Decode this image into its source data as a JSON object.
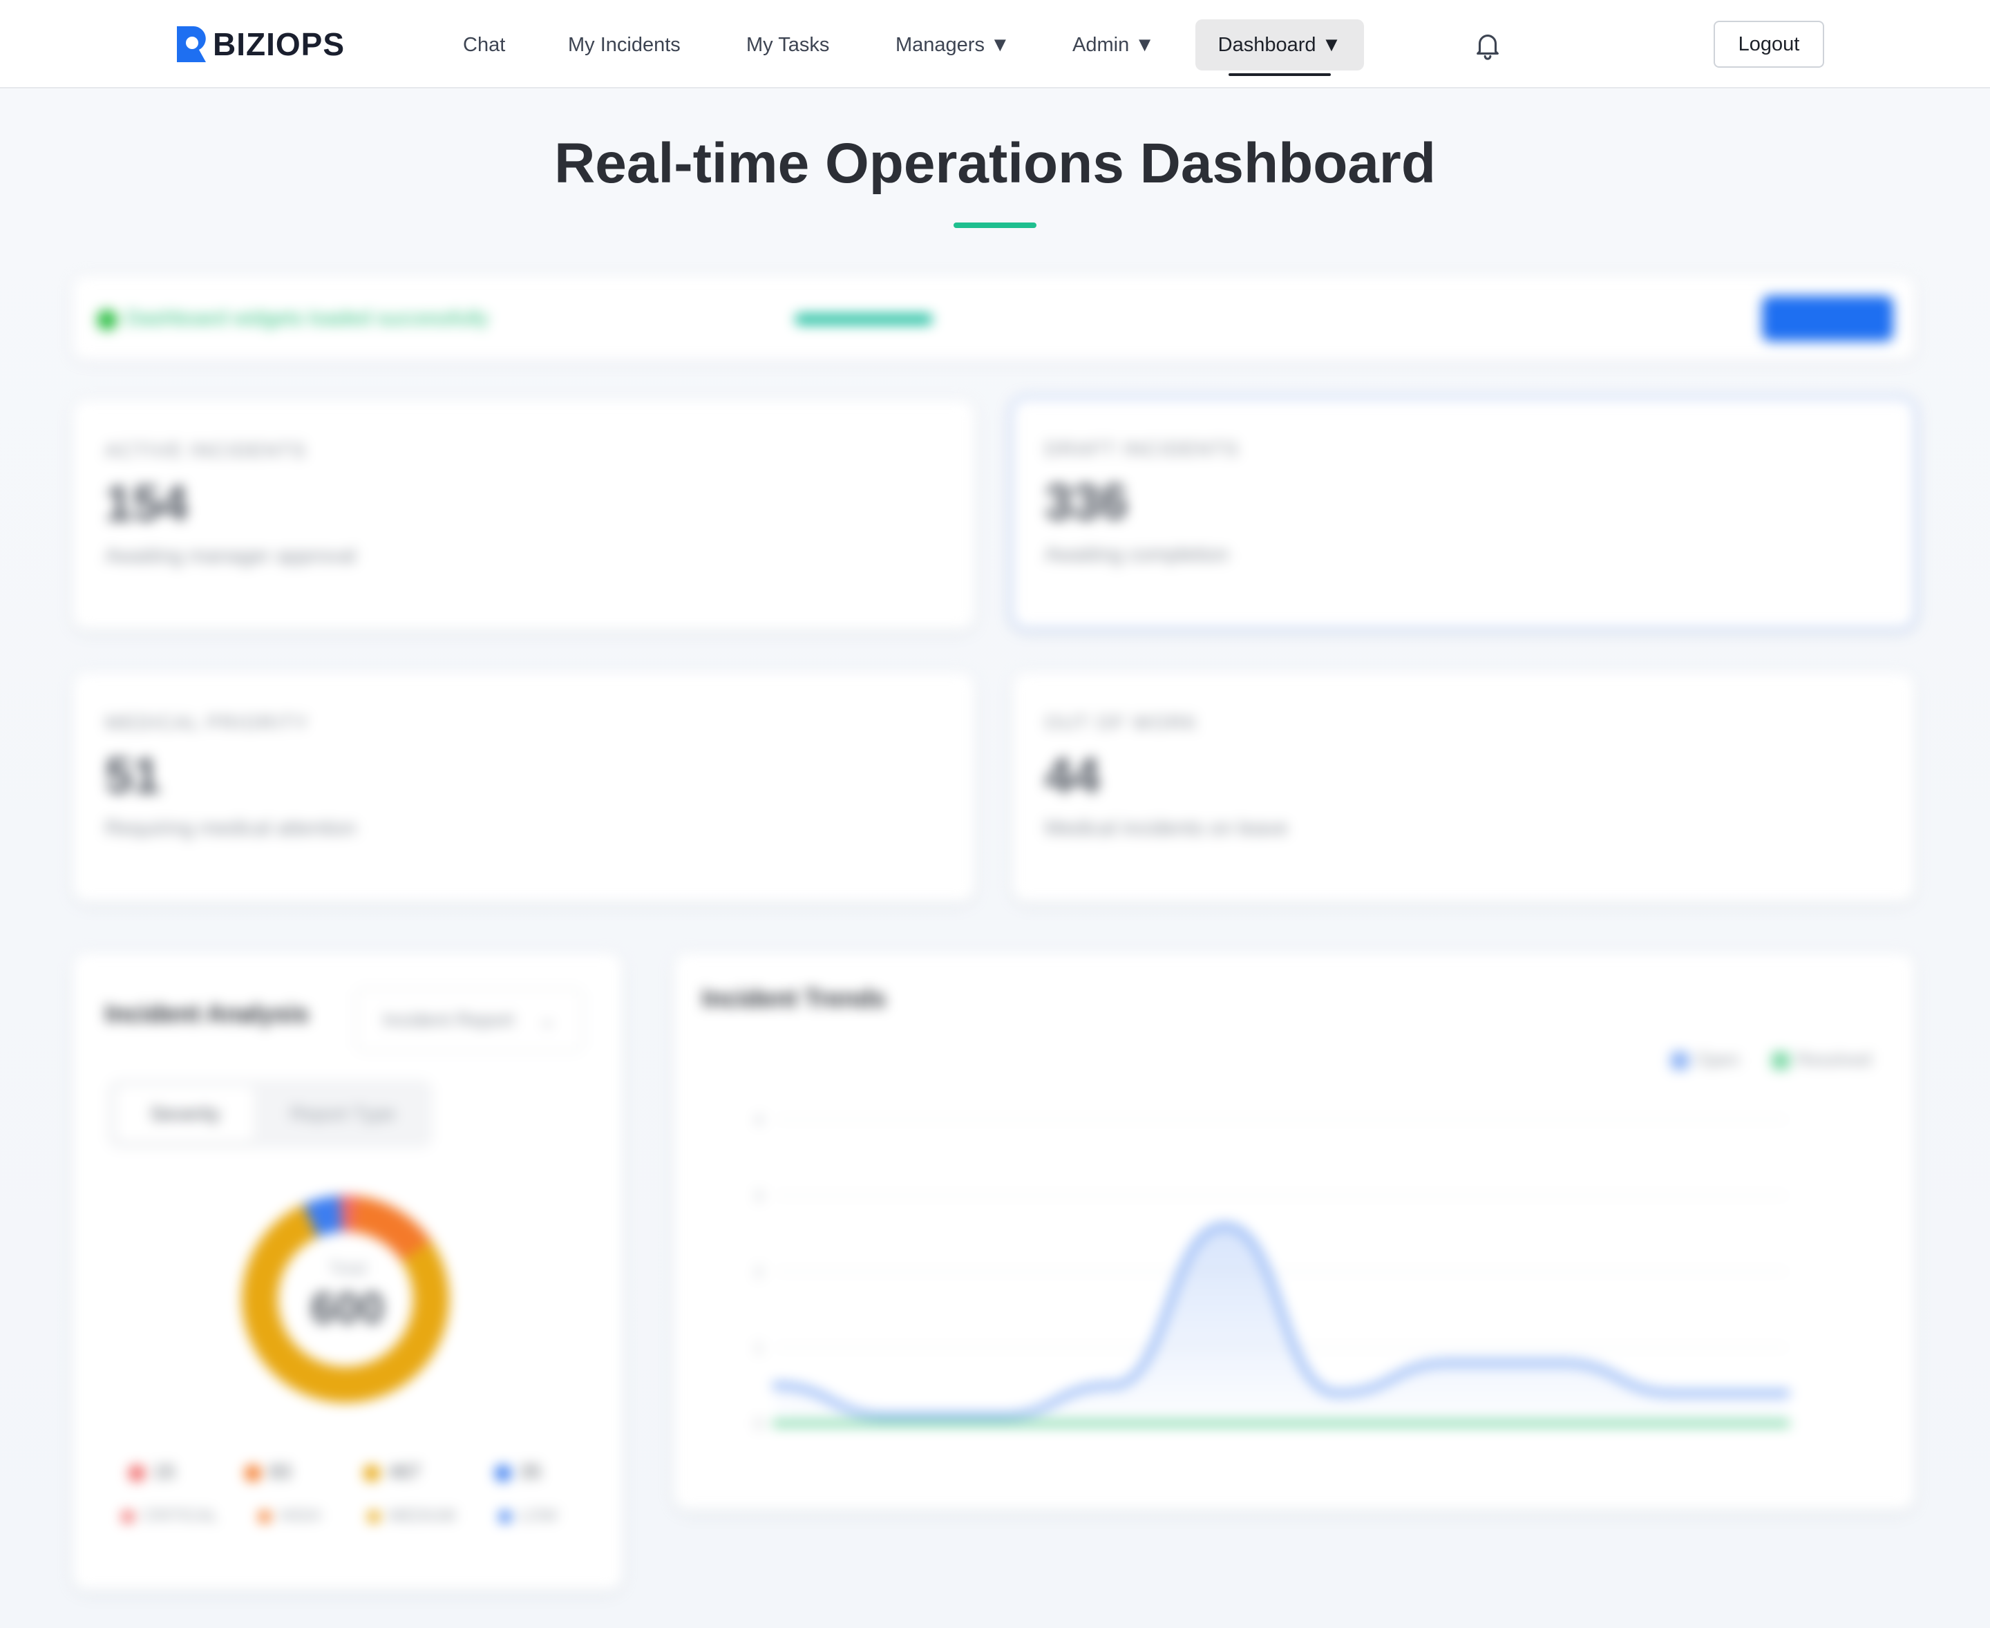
{
  "nav": {
    "logo_text": "BIZIOPS",
    "items": [
      {
        "label": "Chat"
      },
      {
        "label": "My Incidents"
      },
      {
        "label": "My Tasks"
      },
      {
        "label": "Managers ▼"
      },
      {
        "label": "Admin ▼"
      },
      {
        "label": "Dashboard ▼"
      }
    ],
    "logout_label": "Logout",
    "brand_color": "#1e6ff1"
  },
  "page": {
    "title": "Real-time Operations Dashboard",
    "accent_color": "#1fbf8f"
  },
  "status": {
    "message": "Dashboard widgets loaded successfully",
    "time": "",
    "button_label": ""
  },
  "cards": [
    {
      "label": "ACTIVE INCIDENTS",
      "value": "154",
      "desc": "Awaiting manager approval",
      "note": ""
    },
    {
      "label": "DRAFT INCIDENTS",
      "value": "336",
      "desc": "Awaiting completion",
      "note": ""
    },
    {
      "label": "MEDICAL PRIORITY",
      "value": "51",
      "desc": "Requiring medical attention",
      "note": ""
    },
    {
      "label": "OUT OF WORK",
      "value": "44",
      "desc": "Medical incidents on leave",
      "note": ""
    }
  ],
  "analysis": {
    "title": "Incident Analysis",
    "select_value": "Incident Report",
    "segments": [
      "Severity",
      "Report Type"
    ],
    "donut_caption": "Total",
    "donut_total": "600",
    "legend": [
      {
        "count": "15",
        "label": "CRITICAL",
        "color": "#f06a6a"
      },
      {
        "count": "83",
        "label": "HIGH",
        "color": "#f47a2a"
      },
      {
        "count": "467",
        "label": "MEDIUM",
        "color": "#e8a812"
      },
      {
        "count": "35",
        "label": "LOW",
        "color": "#3d7ef0"
      }
    ]
  },
  "chart_data": {
    "type": "line",
    "title": "Incident Trends",
    "series": [
      {
        "name": "Open",
        "color": "#8fb4f5",
        "values": [
          0.5,
          0.1,
          0.1,
          0.5,
          2.6,
          0.4,
          0.8,
          0.8,
          0.4,
          0.4
        ]
      },
      {
        "name": "Resolved",
        "color": "#7fd9a8",
        "values": [
          0,
          0,
          0,
          0,
          0,
          0,
          0,
          0,
          0,
          0
        ]
      }
    ],
    "ylim": [
      0,
      4
    ],
    "grid": true,
    "legend": "top-right"
  }
}
